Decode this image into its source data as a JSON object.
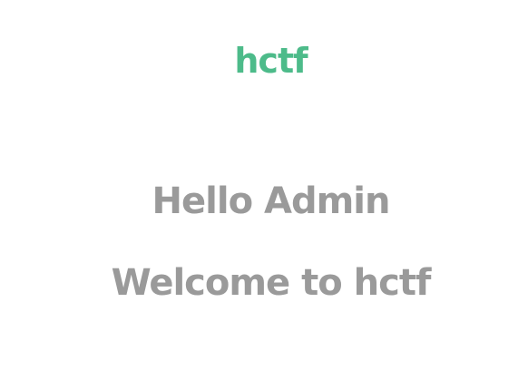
{
  "header": {
    "brand": "hctf",
    "brand_color": "#4dbb8a"
  },
  "main": {
    "greeting": "Hello Admin",
    "welcome": "Welcome to hctf",
    "text_color": "#9a9a9a"
  }
}
